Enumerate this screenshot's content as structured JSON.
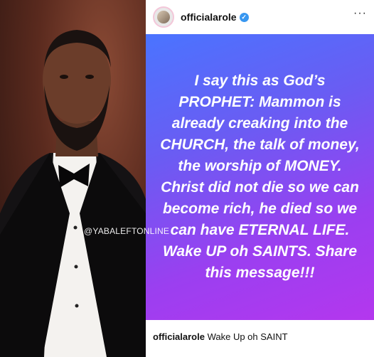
{
  "watermark": "@YABALEFTONLINE",
  "post": {
    "username": "officialarole",
    "message": "I say this as God’s PROPHET: Mammon is already creaking into the CHURCH, the talk of money, the worship of MONEY. Christ did not die so we can become rich, he died so we can have ETERNAL LIFE. Wake UP oh SAINTS. Share this message!!!",
    "caption_user": "officialarole",
    "caption_text": "Wake Up oh SAINT"
  },
  "colors": {
    "gradient_start": "#4a74ff",
    "gradient_end": "#b437ee",
    "verified": "#3897f0"
  },
  "icons": [
    "verified-badge-icon",
    "more-options-icon"
  ]
}
